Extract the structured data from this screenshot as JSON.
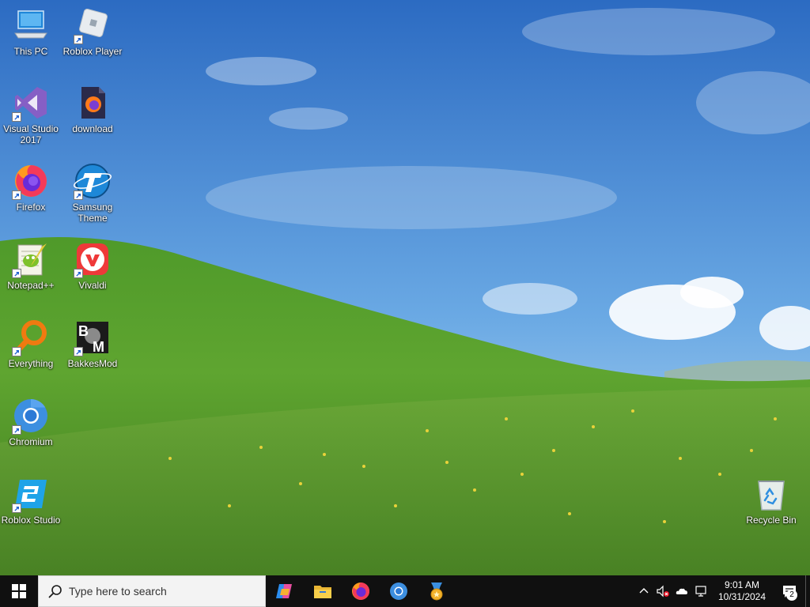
{
  "colors": {
    "sky_top": "#2f6fc4",
    "sky_bottom": "#a7d2f0",
    "grass_light": "#7fb83a",
    "grass_dark": "#3f7a1c",
    "taskbar": "#101010",
    "search_bg": "#f3f3f3"
  },
  "desktop": {
    "icons": [
      {
        "label": "This PC",
        "icon": "computer-icon"
      },
      {
        "label": "Roblox Player",
        "icon": "roblox-icon"
      },
      {
        "label": "Visual Studio 2017",
        "icon": "visual-studio-icon"
      },
      {
        "label": "download",
        "icon": "firefox-file-icon"
      },
      {
        "label": "Firefox",
        "icon": "firefox-icon"
      },
      {
        "label": "Samsung Theme",
        "icon": "samsung-theme-icon"
      },
      {
        "label": "Notepad++",
        "icon": "notepadpp-icon"
      },
      {
        "label": "Vivaldi",
        "icon": "vivaldi-icon"
      },
      {
        "label": "Everything",
        "icon": "everything-search-icon"
      },
      {
        "label": "BakkesMod",
        "icon": "bakkesmod-icon"
      },
      {
        "label": "Chromium",
        "icon": "chromium-icon"
      },
      {
        "label": "Roblox Studio",
        "icon": "roblox-studio-icon"
      },
      {
        "label": "Recycle Bin",
        "icon": "recycle-bin-icon"
      }
    ]
  },
  "taskbar": {
    "search_placeholder": "Type here to search",
    "pinned": [
      {
        "icon": "copilot-icon"
      },
      {
        "icon": "file-explorer-icon"
      },
      {
        "icon": "firefox-icon"
      },
      {
        "icon": "chromium-icon"
      },
      {
        "icon": "medal-icon"
      }
    ],
    "clock": {
      "time": "9:01 AM",
      "date": "10/31/2024"
    },
    "notification_count": "2"
  }
}
